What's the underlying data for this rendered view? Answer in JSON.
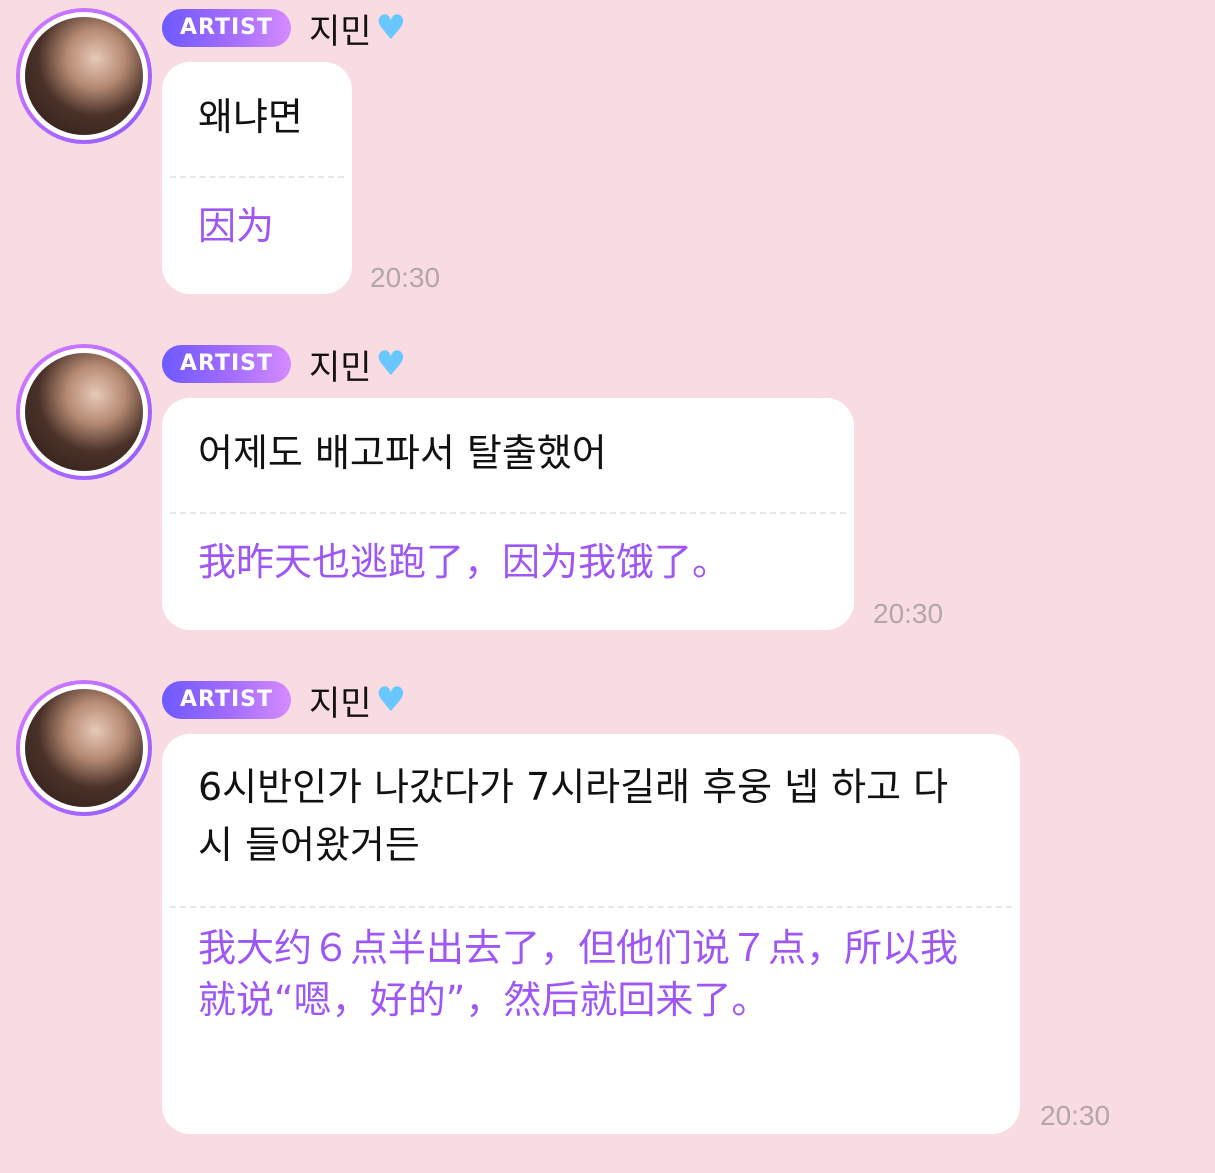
{
  "sender": {
    "badge": "ARTIST",
    "name": "지민",
    "heart_icon": "light-blue-heart-icon",
    "avatar_icon": "profile-photo"
  },
  "messages": [
    {
      "original": "왜냐면",
      "translation": "因为",
      "time": "20:30"
    },
    {
      "original": "어제도 배고파서 탈출했어",
      "translation": "我昨天也逃跑了，因为我饿了。",
      "time": "20:30"
    },
    {
      "original": "6시반인가 나갔다가 7시라길래 후웅 넵 하고 다시 들어왔거든",
      "translation": "我大约６点半出去了，但他们说７点，所以我就说“嗯，好的”，然后就回来了。",
      "time": "20:30"
    }
  ],
  "colors": {
    "background": "#f9dce2",
    "bubble": "#ffffff",
    "translation_text": "#9e56f4",
    "time_text": "#b3a5aa",
    "badge_gradient_start": "#6d59ff",
    "badge_gradient_end": "#d48bff",
    "heart": "#68c7ff"
  }
}
